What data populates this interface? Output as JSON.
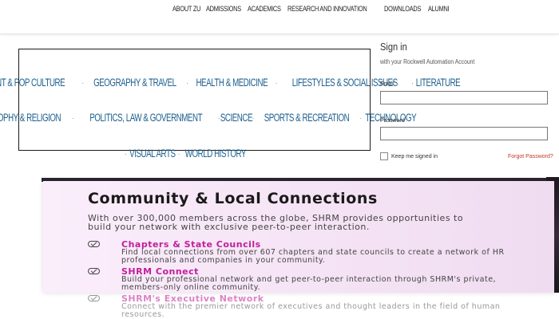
{
  "top_nav": {
    "items": [
      "ABOUT ZU",
      "ADMISSIONS",
      "ACADEMICS",
      "RESEARCH AND INNOVATION",
      "DOWNLOADS",
      "ALUMNI"
    ]
  },
  "categories": {
    "row1": [
      "ENTERTAINMENT & POP CULTURE",
      "GEOGRAPHY & TRAVEL",
      "HEALTH & MEDICINE",
      "LIFESTYLES & SOCIAL ISSUES",
      "LITERATURE"
    ],
    "row2": [
      "PHILOSOPHY & RELIGION",
      "POLITICS, LAW & GOVERNMENT",
      "SCIENCE",
      "SPORTS & RECREATION",
      "TECHNOLOGY"
    ],
    "row3": [
      "VISUAL ARTS",
      "WORLD HISTORY"
    ],
    "color": "#1b5e8d"
  },
  "signin": {
    "title": "Sign in",
    "subtitle": "with your Rockwell Automation Account",
    "email_label": "Email",
    "password_label": "Password",
    "keep_signed_in": "Keep me signed in",
    "forgot_password": "Forgot Password?",
    "forgot_color": "#c0392b"
  },
  "community": {
    "title": "Community & Local Connections",
    "intro": "With over 300,000 members across the globe, SHRM provides opportunities to build your network with exclusive peer-to-peer interaction.",
    "items": [
      {
        "title": "Chapters & State Councils",
        "desc": "Find local connections from over 607 chapters and state councils to create a network of HR professionals and companies in your community."
      },
      {
        "title": "SHRM Connect",
        "desc": "Build your professional network and get peer-to-peer interaction through SHRM's private, members-only online community."
      },
      {
        "title": "SHRM's Executive Network",
        "desc": "Connect with the premier network of executives and thought leaders in the field of human resources."
      }
    ],
    "accent_color": "#c21d9c"
  }
}
